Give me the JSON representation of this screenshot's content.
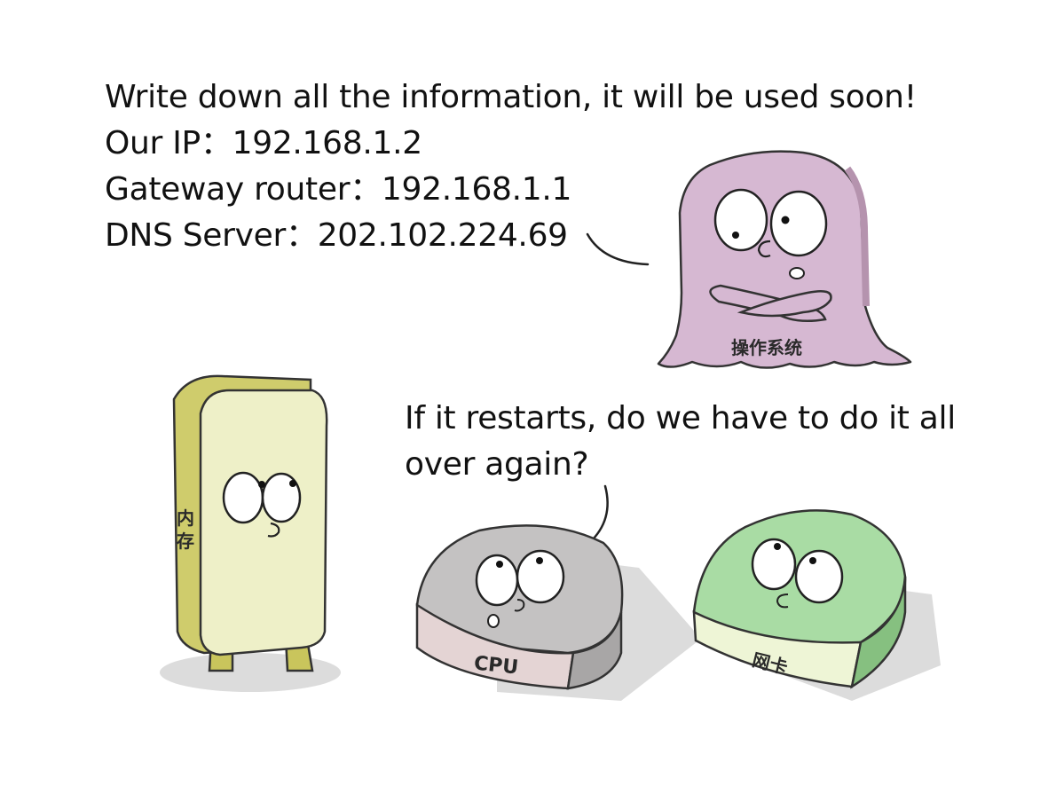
{
  "os_speech": {
    "line1": "Write down all the information, it will be used soon!",
    "line2": "Our IP：192.168.1.2",
    "line3": "Gateway router：192.168.1.1",
    "line4": "DNS Server：202.102.224.69"
  },
  "cpu_speech": {
    "line1": "If it restarts, do we have to do it all",
    "line2": "over again?"
  },
  "characters": {
    "os_label": "操作系统",
    "memory_label_1": "内",
    "memory_label_2": "存",
    "cpu_label": "CPU",
    "nic_label": "网卡"
  },
  "colors": {
    "os_body": "#d6b8d2",
    "memory_front": "#eef0c8",
    "memory_side": "#cfcc6c",
    "cpu_body": "#c4c2c2",
    "nic_body": "#a9dca4",
    "shadow": "#dcdcdc"
  }
}
